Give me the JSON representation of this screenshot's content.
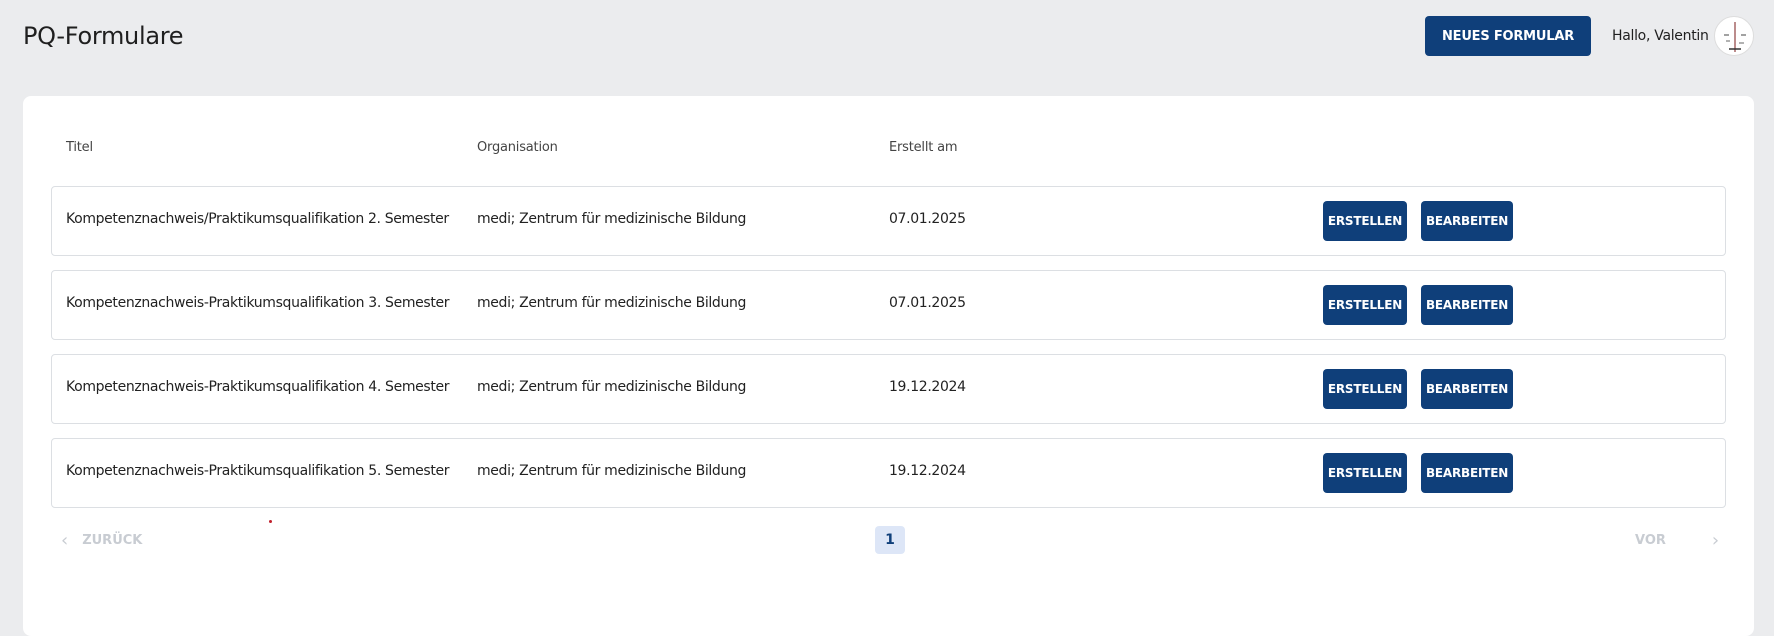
{
  "header": {
    "title": "PQ-Formulare",
    "new_form_label": "NEUES FORMULAR",
    "greeting": "Hallo, Valentin",
    "avatar_icon": "avatar-clock-icon"
  },
  "table": {
    "columns": {
      "title": "Titel",
      "organisation": "Organisation",
      "created": "Erstellt am"
    },
    "rows": [
      {
        "title": "Kompetenznachweis/Praktikumsqualifikation 2. Semester",
        "organisation": "medi; Zentrum für medizinische Bildung",
        "created": "07.01.2025",
        "create_label": "ERSTELLEN",
        "edit_label": "BEARBEITEN"
      },
      {
        "title": "Kompetenznachweis-Praktikumsqualifikation 3. Semester",
        "organisation": "medi; Zentrum für medizinische Bildung",
        "created": "07.01.2025",
        "create_label": "ERSTELLEN",
        "edit_label": "BEARBEITEN"
      },
      {
        "title": "Kompetenznachweis-Praktikumsqualifikation 4. Semester",
        "organisation": "medi; Zentrum für medizinische Bildung",
        "created": "19.12.2024",
        "create_label": "ERSTELLEN",
        "edit_label": "BEARBEITEN"
      },
      {
        "title": "Kompetenznachweis-Praktikumsqualifikation 5. Semester",
        "organisation": "medi; Zentrum für medizinische Bildung",
        "created": "19.12.2024",
        "create_label": "ERSTELLEN",
        "edit_label": "BEARBEITEN"
      }
    ]
  },
  "pagination": {
    "prev_label": "ZURÜCK",
    "next_label": "VOR",
    "current_page": "1"
  },
  "colors": {
    "primary": "#0f3f7a",
    "background": "#ebecee",
    "disabled": "#c8ccd2",
    "page_active_bg": "#dde6f7"
  }
}
